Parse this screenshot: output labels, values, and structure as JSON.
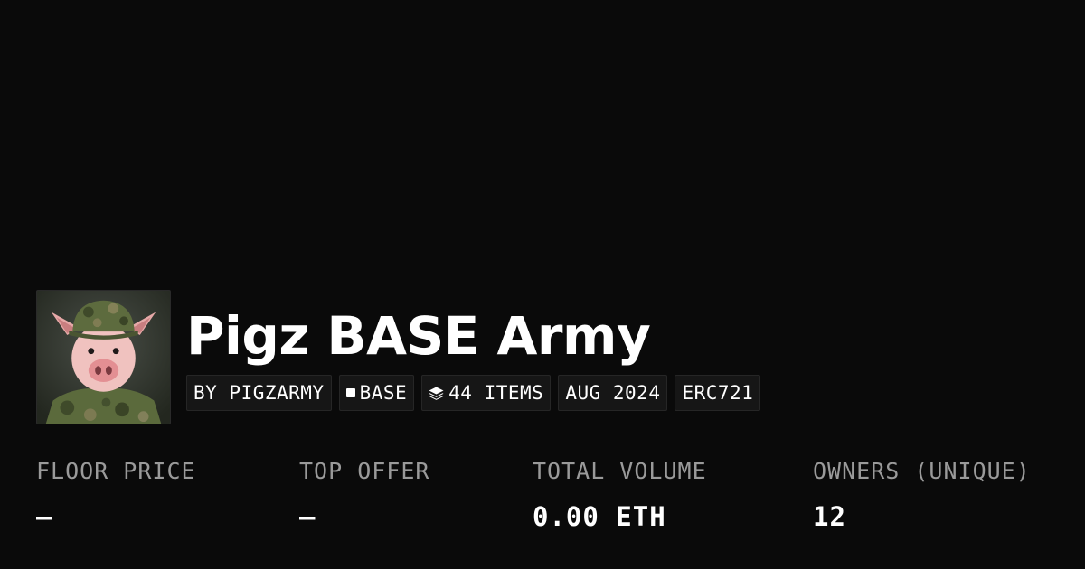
{
  "collection": {
    "name": "Pigz BASE Army",
    "avatar_icon": "pig-soldier-avatar"
  },
  "badges": {
    "creator": "BY PIGZARMY",
    "chain": "BASE",
    "chain_icon": "square-icon",
    "items": "44 ITEMS",
    "items_icon": "layers-icon",
    "date": "AUG 2024",
    "standard": "ERC721"
  },
  "stats": {
    "floor_price": {
      "label": "FLOOR PRICE",
      "value": "–"
    },
    "top_offer": {
      "label": "TOP OFFER",
      "value": "–"
    },
    "total_volume": {
      "label": "TOTAL VOLUME",
      "value": "0.00 ETH"
    },
    "owners": {
      "label": "OWNERS (UNIQUE)",
      "value": "12"
    }
  },
  "colors": {
    "background": "#0a0a0a",
    "text": "#ffffff",
    "muted_text": "#9a9a9a",
    "badge_background": "#161616"
  }
}
